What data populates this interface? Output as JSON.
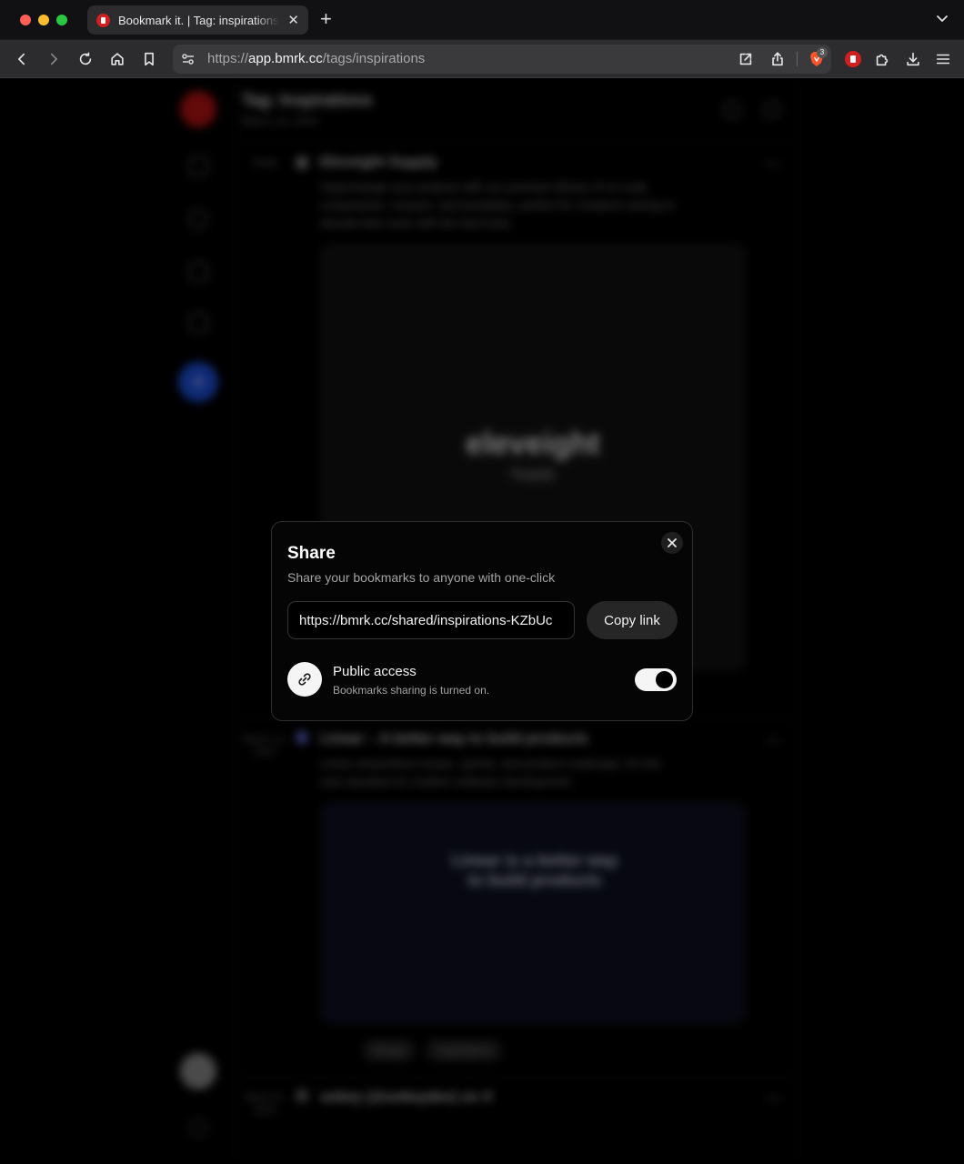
{
  "browser": {
    "tab_title": "Bookmark it. | Tag: inspirations",
    "tab_close_glyph": "✕",
    "new_tab_glyph": "+",
    "url_scheme": "https://",
    "url_host": "app.bmrk.cc",
    "url_path": "/tags/inspirations",
    "shields_count": "3"
  },
  "page": {
    "title": "Tag: Inspirations",
    "date": "March 14, 2024",
    "entries": [
      {
        "date": "Today",
        "title": "Eleveight Supply",
        "description": "Supercharge your projects with our premium library of no-code components, remixes, and templates, perfect for creatives aiming to elevate their work with the best tools.",
        "image_brand": "eleveight",
        "image_sub": "Supply"
      },
      {
        "date": "March 13, 2024",
        "title": "Linear – A better way to build products",
        "description": "Linear streamlines issues, sprints, and product roadmaps. It's the new standard for modern software development.",
        "image_headline": "Linear is a better way to build products",
        "tags": [
          "design",
          "inspirations"
        ]
      },
      {
        "date": "March 8, 2024",
        "title": "unkey (@unkeydev) on X"
      }
    ]
  },
  "dialog": {
    "title": "Share",
    "subtitle": "Share your bookmarks to anyone with one-click",
    "share_url": "https://bmrk.cc/shared/inspirations-KZbUc",
    "copy_label": "Copy link",
    "access_label": "Public access",
    "access_status": "Bookmarks sharing is turned on.",
    "public_access_enabled": true
  },
  "icons": {
    "back": "back-arrow-icon",
    "forward": "forward-arrow-icon",
    "reload": "reload-icon",
    "home": "home-icon",
    "bookmark": "bookmark-icon",
    "close": "close-icon",
    "link": "link-icon"
  },
  "colors": {
    "accent": "#f5f5f5",
    "brand": "#d21f1f",
    "dialog_bg": "#050505"
  }
}
